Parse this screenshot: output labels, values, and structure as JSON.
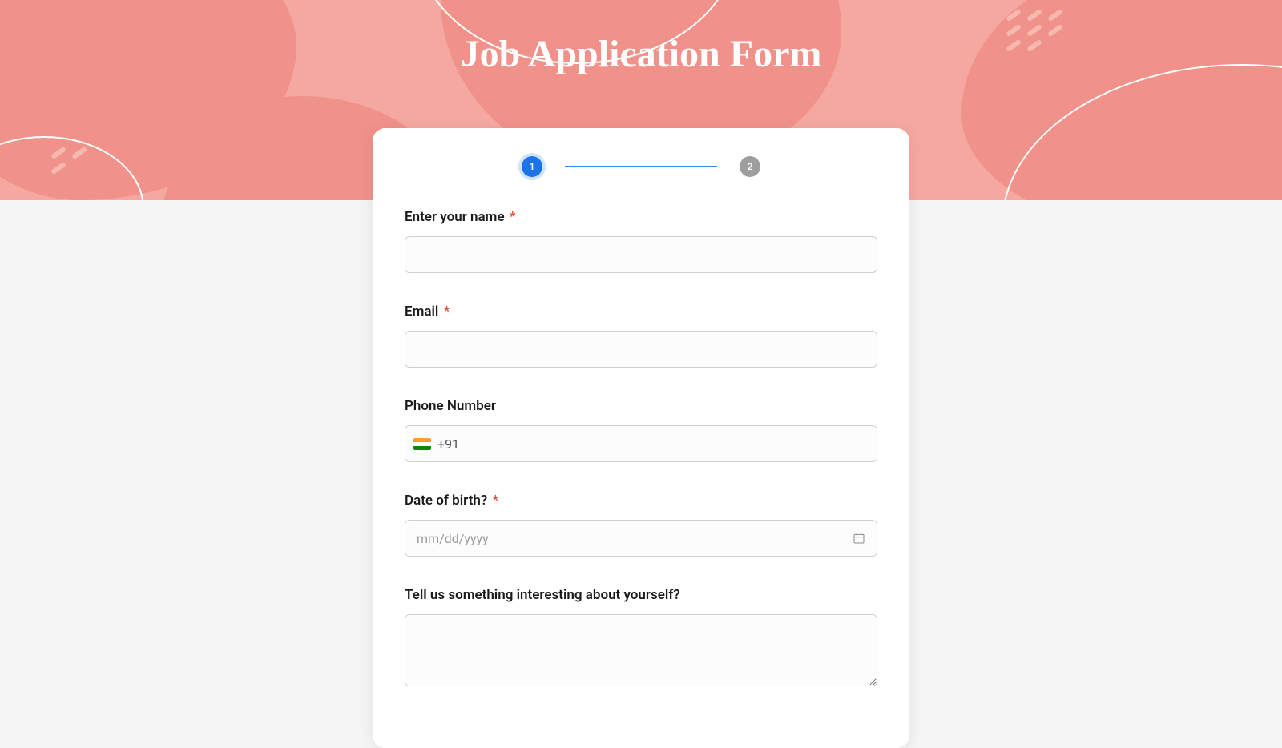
{
  "header": {
    "title": "Job Application Form"
  },
  "stepper": {
    "steps": [
      "1",
      "2"
    ],
    "active_step": 0
  },
  "form": {
    "name": {
      "label": "Enter your name",
      "required": true,
      "value": ""
    },
    "email": {
      "label": "Email",
      "required": true,
      "value": ""
    },
    "phone": {
      "label": "Phone Number",
      "required": false,
      "country_flag": "india",
      "prefix": "+91",
      "value": ""
    },
    "dob": {
      "label": "Date of birth?",
      "required": true,
      "placeholder": "mm/dd/yyyy",
      "value": ""
    },
    "about": {
      "label": "Tell us something interesting about yourself?",
      "required": false,
      "value": ""
    }
  }
}
